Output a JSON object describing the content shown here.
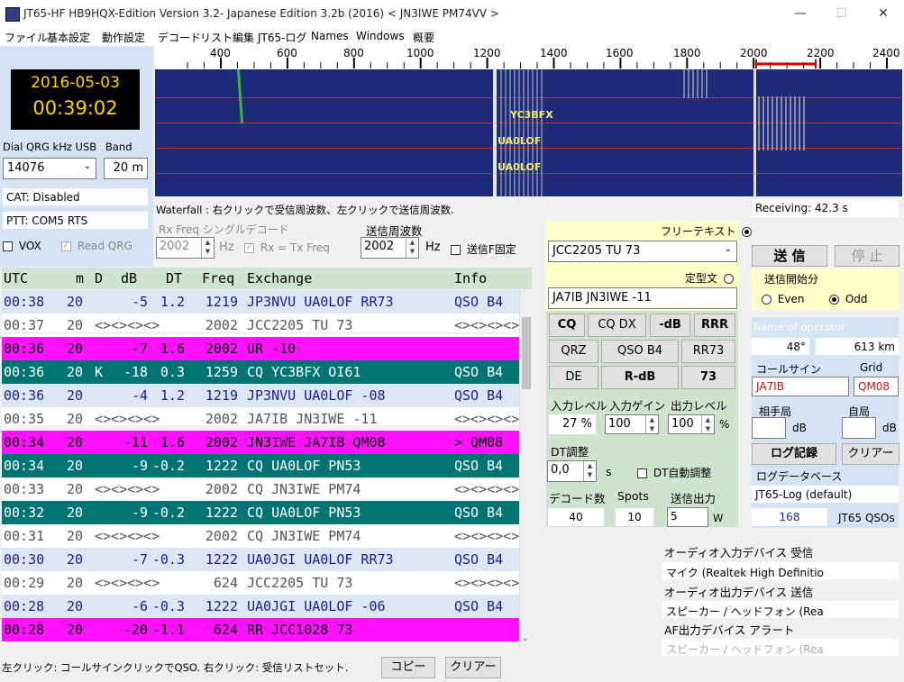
{
  "window": {
    "title": "JT65-HF HB9HQX-Edition Version 3.2- Japanese Edition 3.2b (2016)   < JN3IWE PM74VV >",
    "minimize": "—",
    "maximize": "☐",
    "close": "✕"
  },
  "menu": [
    "ファイル",
    "基本設定",
    "動作設定",
    "デコード",
    "リスト編集",
    "JT65-ログ",
    "Names",
    "Windows",
    "概要"
  ],
  "clock": {
    "date": "2016-05-03",
    "time": "00:39:02"
  },
  "dial": {
    "label": "Dial QRG kHz USB",
    "value": "14076",
    "band_label": "Band",
    "band_value": "20 m"
  },
  "cat": "CAT: Disabled",
  "ptt": "PTT: COM5 RTS",
  "vox_label": "VOX",
  "read_qrg_label": "Read QRG",
  "ruler_labels": [
    "400",
    "600",
    "800",
    "1000",
    "1200",
    "1400",
    "1600",
    "1800",
    "2000",
    "2200",
    "2400"
  ],
  "waterfall": {
    "labels": [
      "YC3BFX",
      "UA0LOF",
      "UA0LOF"
    ],
    "hint": "Waterfall : 右クリックで受信周波数、左クリックで送信周波数.",
    "receiving": "Receiving: 42.3 s"
  },
  "rxfreq": {
    "label": "Rx Freq シングルデコード",
    "value": "2002",
    "unit": "Hz",
    "rx_eq_tx": "Rx = Tx Freq"
  },
  "txfreq": {
    "label": "送信周波数",
    "value": "2002",
    "unit": "Hz",
    "fixed": "送信F固定"
  },
  "decode_header": {
    "utc": "UTC",
    "m": "m",
    "d": "D",
    "db": "dB",
    "dt": "DT",
    "freq": "Freq",
    "exchange": "Exchange",
    "info": "Info"
  },
  "rows": [
    {
      "utc": "00:38",
      "m": "20",
      "d": "",
      "db": "-5",
      "dt": "1.2",
      "freq": "1219",
      "ex": "JP3NVU UA0LOF RR73",
      "info": "QSO B4",
      "bg": "#dce6f4",
      "fg": "#1c1c9a"
    },
    {
      "utc": "00:37",
      "m": "20",
      "d": "",
      "db": "<><><><>",
      "dt": "",
      "freq": "2002",
      "ex": "JCC2205 TU 73",
      "info": "<><><><><><><>",
      "bg": "#ffffff",
      "fg": "#555555"
    },
    {
      "utc": "00:36",
      "m": "20",
      "d": "",
      "db": "-7",
      "dt": "1.6",
      "freq": "2002",
      "ex": "UR -10",
      "info": "",
      "bg": "#ff10ff",
      "fg": "#000000"
    },
    {
      "utc": "00:36",
      "m": "20",
      "d": "K",
      "db": "-18",
      "dt": "0.3",
      "freq": "1259",
      "ex": "CQ YC3BFX OI61",
      "info": "QSO B4",
      "bg": "#007373",
      "fg": "#ffffff"
    },
    {
      "utc": "00:36",
      "m": "20",
      "d": "",
      "db": "-4",
      "dt": "1.2",
      "freq": "1219",
      "ex": "JP3NVU UA0LOF -08",
      "info": "QSO B4",
      "bg": "#dce6f4",
      "fg": "#1c1c9a"
    },
    {
      "utc": "00:35",
      "m": "20",
      "d": "",
      "db": "<><><><>",
      "dt": "",
      "freq": "2002",
      "ex": "JA7IB JN3IWE -11",
      "info": "<><><><><><><>",
      "bg": "#ffffff",
      "fg": "#555555"
    },
    {
      "utc": "00:34",
      "m": "20",
      "d": "",
      "db": "-11",
      "dt": "1.6",
      "freq": "2002",
      "ex": "JN3IWE JA7IB QM08",
      "info": "> QM08",
      "bg": "#ff10ff",
      "fg": "#000000"
    },
    {
      "utc": "00:34",
      "m": "20",
      "d": "",
      "db": "-9",
      "dt": "-0.2",
      "freq": "1222",
      "ex": "CQ UA0LOF PN53",
      "info": "QSO B4",
      "bg": "#007373",
      "fg": "#ffffff"
    },
    {
      "utc": "00:33",
      "m": "20",
      "d": "",
      "db": "<><><><>",
      "dt": "",
      "freq": "2002",
      "ex": "CQ JN3IWE PM74",
      "info": "<><><><><><><>",
      "bg": "#ffffff",
      "fg": "#555555"
    },
    {
      "utc": "00:32",
      "m": "20",
      "d": "",
      "db": "-9",
      "dt": "-0.2",
      "freq": "1222",
      "ex": "CQ UA0LOF PN53",
      "info": "QSO B4",
      "bg": "#007373",
      "fg": "#ffffff"
    },
    {
      "utc": "00:31",
      "m": "20",
      "d": "",
      "db": "<><><><>",
      "dt": "",
      "freq": "2002",
      "ex": "CQ JN3IWE PM74",
      "info": "<><><><><><><>",
      "bg": "#ffffff",
      "fg": "#555555"
    },
    {
      "utc": "00:30",
      "m": "20",
      "d": "",
      "db": "-7",
      "dt": "-0.3",
      "freq": "1222",
      "ex": "UA0JGI UA0LOF RR73",
      "info": "QSO B4",
      "bg": "#dce6f4",
      "fg": "#1c1c9a"
    },
    {
      "utc": "00:29",
      "m": "20",
      "d": "",
      "db": "<><><><>",
      "dt": "",
      "freq": "624",
      "ex": "JCC2205 TU 73",
      "info": "<><><><><><><>",
      "bg": "#ffffff",
      "fg": "#555555"
    },
    {
      "utc": "00:28",
      "m": "20",
      "d": "",
      "db": "-6",
      "dt": "-0.3",
      "freq": "1222",
      "ex": "UA0JGI UA0LOF -06",
      "info": "QSO B4",
      "bg": "#dce6f4",
      "fg": "#1c1c9a"
    },
    {
      "utc": "00:28",
      "m": "20",
      "d": "",
      "db": "-20",
      "dt": "-1.1",
      "freq": "624",
      "ex": "RR JCC1028 73",
      "info": "",
      "bg": "#ff10ff",
      "fg": "#000000"
    }
  ],
  "status_bar": "左クリック: コールサインクリックでQSO. 右クリック: 受信リストセット.",
  "copy_button": "コピー",
  "clear_button": "クリアー",
  "free_text": {
    "label": "フリーテキスト",
    "value": "JCC2205 TU 73"
  },
  "template_text": {
    "label": "定型文",
    "value": "JA7IB JN3IWE -11"
  },
  "macro_buttons": [
    [
      "CQ",
      "CQ DX",
      "-dB",
      "RRR"
    ],
    [
      "QRZ",
      "QSO B4",
      "RR73"
    ],
    [
      "DE",
      "R-dB",
      "73"
    ]
  ],
  "levels": {
    "input_level": "入力レベル",
    "input_gain": "入力ゲイン",
    "output_level": "出力レベル",
    "input_level_value": "27 %",
    "input_gain_value": "100",
    "output_level_value": "100",
    "percent": "%"
  },
  "dt": {
    "label": "DT調整",
    "value": "0,0",
    "unit": "s",
    "auto": "DT自動調整"
  },
  "counts": {
    "decode_label": "デコード数",
    "spots_label": "Spots",
    "tx_label": "送信出力",
    "decode_value": "40",
    "spots_value": "10",
    "tx_value": "5",
    "tx_unit": "W"
  },
  "tx": {
    "send": "送 信",
    "stop": "停 止",
    "start_label": "送信開始分",
    "even": "Even",
    "odd": "Odd"
  },
  "operator": {
    "name_label": "Name of operator",
    "azimuth": "48°",
    "distance": "613 km",
    "callsign_label": "コールサイン",
    "grid_label": "Grid",
    "callsign": "JA7IB",
    "grid": "QM08",
    "their_station": "相手局",
    "my_station": "自局",
    "db1": "dB",
    "db2": "dB"
  },
  "log": {
    "record": "ログ記録",
    "clear": "クリアー",
    "db_label": "ログデータベース",
    "db_value": "JT65-Log (default)",
    "count": "168",
    "qsos": "JT65 QSOs"
  },
  "audio": [
    "オーディオ入力デバイス  受信",
    "マイク (Realtek High Definitio",
    "オーディオ出力デバイス  送信",
    "スピーカー / ヘッドフォン (Rea",
    "AF出力デバイス  アラート",
    "スピーカー / ヘッドフォン (Rea"
  ],
  "colors": {
    "waterfall_bg": "#1c2c78",
    "panel_blue": "#d5e3f5",
    "yellow_panel": "#ffffc8",
    "green_panel": "#cfe3ce",
    "clock_text": "#ffd400"
  }
}
